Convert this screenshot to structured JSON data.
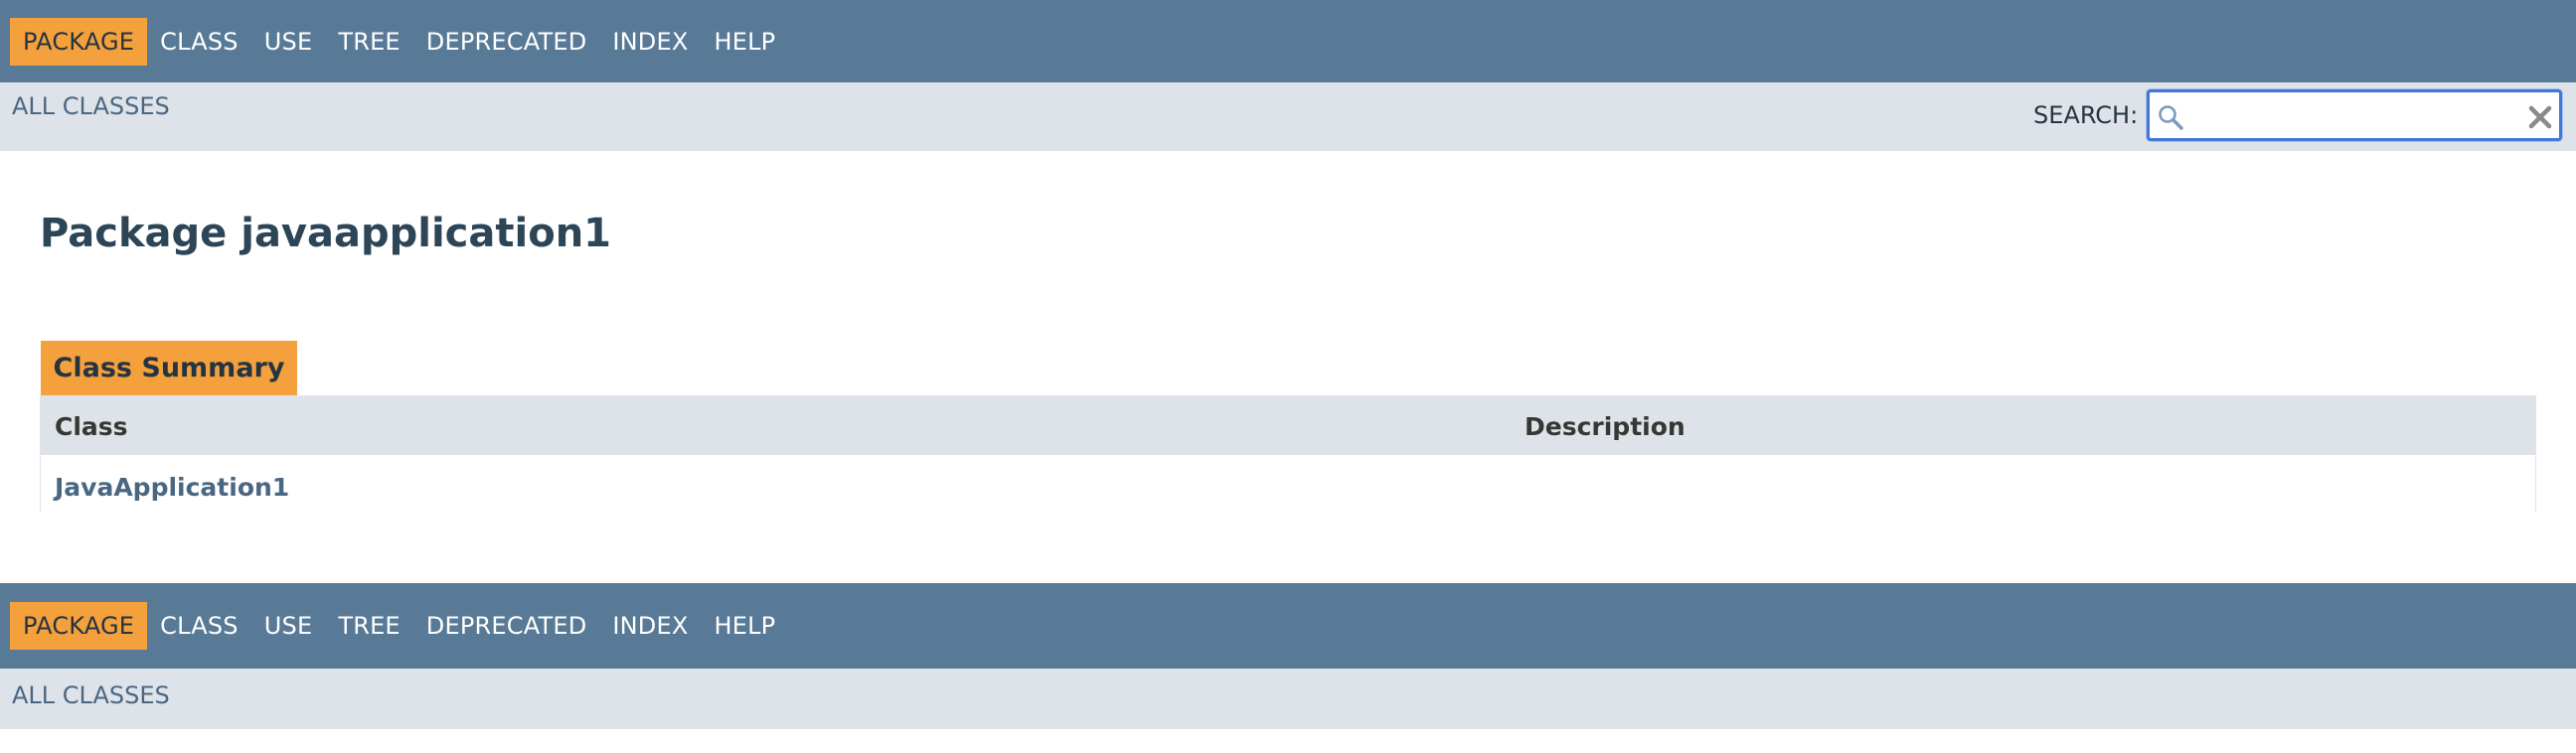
{
  "colors": {
    "nav_bg": "#587a96",
    "nav_active_bg": "#f3a03d",
    "subnav_bg": "#dee3e9",
    "link": "#4a6782",
    "title": "#2c4557"
  },
  "top_nav": {
    "items": [
      "PACKAGE",
      "CLASS",
      "USE",
      "TREE",
      "DEPRECATED",
      "INDEX",
      "HELP"
    ],
    "active": "PACKAGE"
  },
  "sub_nav": {
    "all_classes": "ALL CLASSES",
    "search_label": "SEARCH:",
    "search_value": "",
    "search_icon": "magnifier-icon",
    "reset_icon": "reset-x-icon"
  },
  "main": {
    "title": "Package javaapplication1",
    "summary_caption": "Class Summary",
    "columns": [
      "Class",
      "Description"
    ],
    "rows": [
      {
        "class": "JavaApplication1",
        "description": ""
      }
    ]
  },
  "bottom_nav": {
    "items": [
      "PACKAGE",
      "CLASS",
      "USE",
      "TREE",
      "DEPRECATED",
      "INDEX",
      "HELP"
    ],
    "active": "PACKAGE",
    "all_classes": "ALL CLASSES"
  }
}
